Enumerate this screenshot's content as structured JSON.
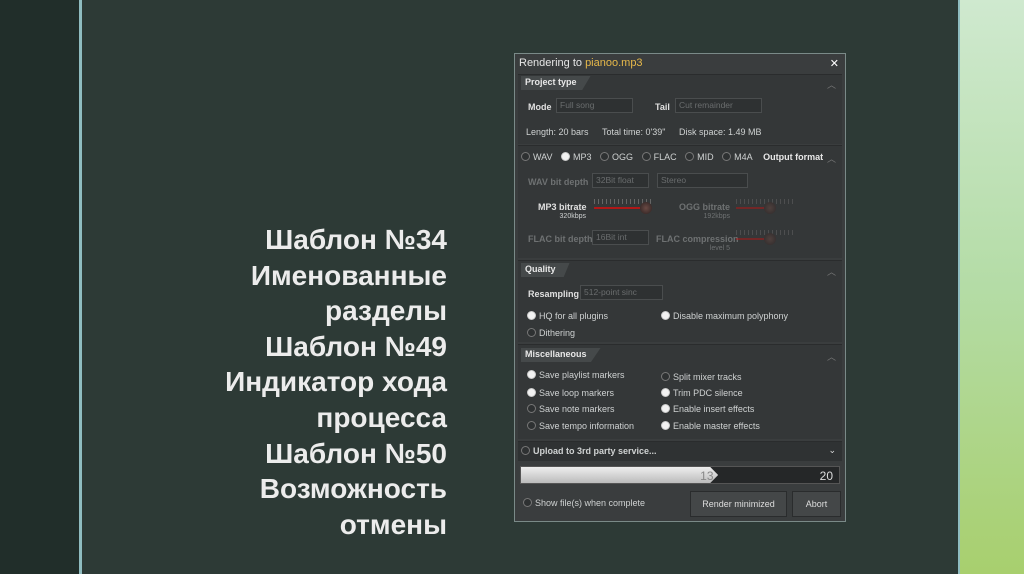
{
  "slide": {
    "lines": [
      "Шаблон №34",
      "Именованные",
      "разделы",
      "Шаблон №49",
      "Индикатор хода",
      "процесса",
      "Шаблон №50",
      "Возможность",
      "отмены"
    ]
  },
  "dialog": {
    "title_prefix": "Rendering to",
    "filename": "pianoo.mp3",
    "close": "✕",
    "project_type": {
      "header": "Project type",
      "mode_label": "Mode",
      "mode_value": "Full song",
      "tail_label": "Tail",
      "tail_value": "Cut remainder",
      "length": "Length: 20 bars",
      "total_time": "Total time: 0'39\"",
      "disk_space": "Disk space: 1.49 MB"
    },
    "output_format": {
      "header": "Output format",
      "formats": [
        {
          "label": "WAV",
          "on": false
        },
        {
          "label": "MP3",
          "on": true
        },
        {
          "label": "OGG",
          "on": false
        },
        {
          "label": "FLAC",
          "on": false
        },
        {
          "label": "MID",
          "on": false
        },
        {
          "label": "M4A",
          "on": false
        }
      ],
      "wav_bit_depth_label": "WAV bit depth",
      "wav_bit_depth": "32Bit float",
      "channels": "Stereo",
      "mp3_bitrate_label": "MP3 bitrate",
      "mp3_bitrate": "320kbps",
      "mp3_level": 1.0,
      "ogg_bitrate_label": "OGG bitrate",
      "ogg_bitrate": "192kbps",
      "ogg_level": 0.6,
      "flac_bit_depth_label": "FLAC bit depth",
      "flac_bit_depth": "16Bit int",
      "flac_compression_label": "FLAC compression",
      "flac_compression": "level 5",
      "flac_level": 0.6
    },
    "quality": {
      "header": "Quality",
      "resampling_label": "Resampling",
      "resampling": "512-point sinc",
      "hq": "HQ for all plugins",
      "dithering": "Dithering",
      "disable_poly": "Disable maximum polyphony"
    },
    "misc": {
      "header": "Miscellaneous",
      "left": [
        "Save playlist markers",
        "Save loop markers",
        "Save note markers",
        "Save tempo information"
      ],
      "right": [
        "Split mixer tracks",
        "Trim PDC silence",
        "Enable insert effects",
        "Enable master effects"
      ]
    },
    "upload": "Upload to 3rd party service...",
    "progress": {
      "current": "13",
      "total": "20",
      "fraction": 0.62
    },
    "show_files": "Show file(s) when complete",
    "render_minimized": "Render minimized",
    "abort": "Abort"
  }
}
